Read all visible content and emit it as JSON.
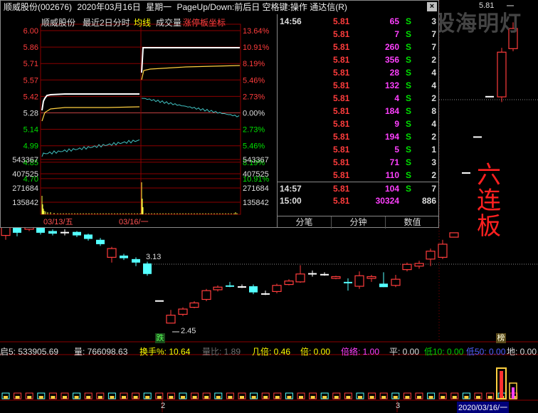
{
  "window": {
    "stock": "顺威股份(002676)",
    "date": "2020年03月16日",
    "weekday": "星期一",
    "hint": "PageUp/Down:前后日 空格键:操作 通达信(R)"
  },
  "popup": {
    "chart_title": "顺威股份",
    "mode": "最近2日分时",
    "avg_label": "均线",
    "vol_label": "成交量",
    "limit_label": "涨停板坐标",
    "close_icon": "x-icon",
    "price_ticks": [
      "6.00",
      "5.86",
      "5.71",
      "5.57",
      "5.42",
      "5.28",
      "5.14",
      "4.99",
      "4.85",
      "4.70"
    ],
    "pct_ticks": [
      "13.64%",
      "10.91%",
      "8.19%",
      "5.46%",
      "2.73%",
      "0.00%",
      "2.73%",
      "5.46%",
      "8.19%",
      "10.91%"
    ],
    "vol_ticks": [
      "543367",
      "407525",
      "271684",
      "135842"
    ],
    "date_labels": [
      "03/13/五",
      "03/16/一"
    ],
    "tabs": [
      "分笔",
      "分钟",
      "数值"
    ],
    "ticks": [
      {
        "time": "14:56",
        "price": "5.81",
        "vol": "65",
        "side": "S",
        "n": "3"
      },
      {
        "time": "",
        "price": "5.81",
        "vol": "7",
        "side": "S",
        "n": "7"
      },
      {
        "time": "",
        "price": "5.81",
        "vol": "260",
        "side": "S",
        "n": "7"
      },
      {
        "time": "",
        "price": "5.81",
        "vol": "356",
        "side": "S",
        "n": "2"
      },
      {
        "time": "",
        "price": "5.81",
        "vol": "28",
        "side": "S",
        "n": "4"
      },
      {
        "time": "",
        "price": "5.81",
        "vol": "132",
        "side": "S",
        "n": "4"
      },
      {
        "time": "",
        "price": "5.81",
        "vol": "4",
        "side": "S",
        "n": "2"
      },
      {
        "time": "",
        "price": "5.81",
        "vol": "184",
        "side": "S",
        "n": "8"
      },
      {
        "time": "",
        "price": "5.81",
        "vol": "9",
        "side": "S",
        "n": "4"
      },
      {
        "time": "",
        "price": "5.81",
        "vol": "194",
        "side": "S",
        "n": "2"
      },
      {
        "time": "",
        "price": "5.81",
        "vol": "5",
        "side": "S",
        "n": "1"
      },
      {
        "time": "",
        "price": "5.81",
        "vol": "71",
        "side": "S",
        "n": "3"
      },
      {
        "time": "",
        "price": "5.81",
        "vol": "110",
        "side": "S",
        "n": "2"
      },
      {
        "time": "14:57",
        "price": "5.81",
        "vol": "104",
        "side": "S",
        "n": "7"
      },
      {
        "time": "15:00",
        "price": "5.81",
        "vol": "30324",
        "side": "",
        "n": "886"
      }
    ]
  },
  "main": {
    "watermark": "股海明灯",
    "annotation": "六连板",
    "top_price": "5.81",
    "mark_high": "3.13",
    "mark_low": "2.45",
    "label_die": "跌",
    "label_bang": "榜",
    "date_badge": "2020/03/16/一",
    "axis_2": "2",
    "axis_3": "3"
  },
  "indicators": {
    "qi5": "启5: 533905.69",
    "liang": "量: 766098.63",
    "huanshou": "换手%: 10.64",
    "liangbi": "量比: 1.89",
    "jibei": "几倍: 0.46",
    "bei": "倍: 0.00",
    "beilv": "倍络: 1.00",
    "ping": "平: 0.00",
    "di10": "低10: 0.00",
    "di50": "低50: 0.00",
    "di": "地: 0.00"
  },
  "colors": {
    "up": "#ff3c3c",
    "down": "#54ffff",
    "flat": "#ffffff",
    "volume": "#ff00ff",
    "yellow": "#ffff00",
    "green": "#00e000",
    "grid": "#8b0000"
  }
}
